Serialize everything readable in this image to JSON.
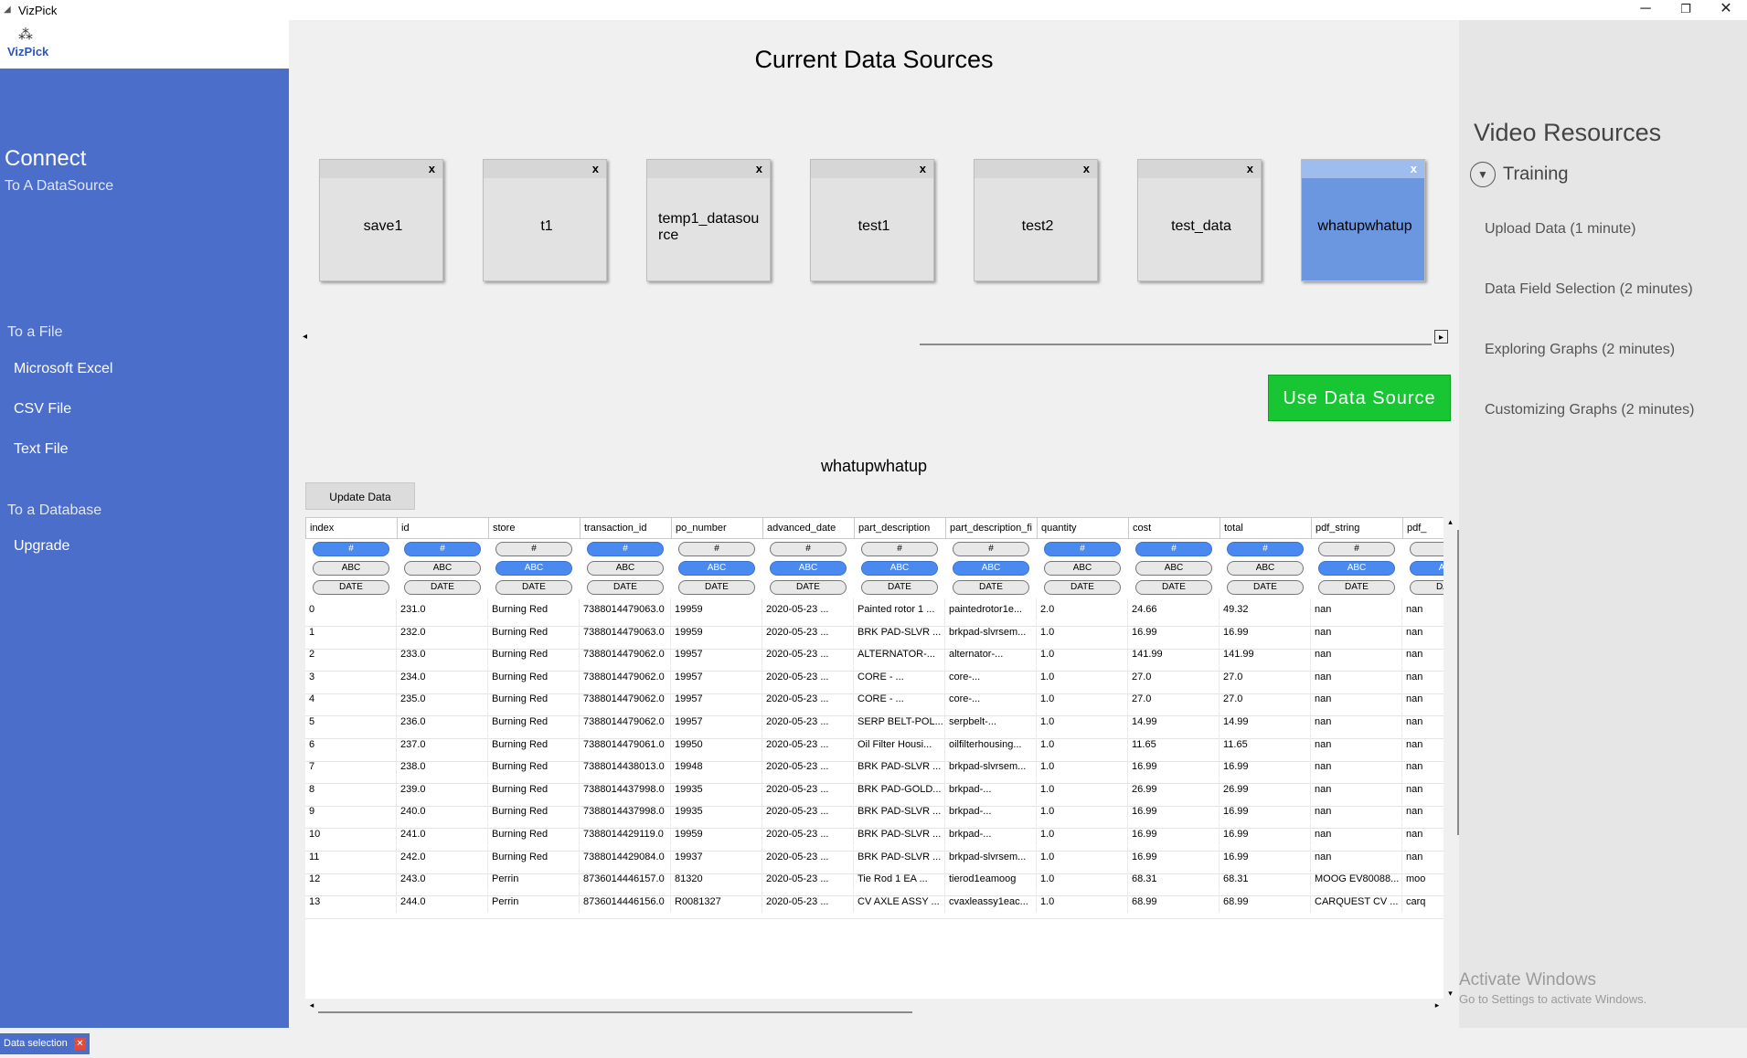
{
  "window": {
    "title": "VizPick",
    "minimize": "─",
    "restore": "❐",
    "close": "✕"
  },
  "logo": {
    "text": "VizPick"
  },
  "sidebar": {
    "title": "Connect",
    "subtitle": "To A DataSource",
    "file_heading": "To a File",
    "file_items": [
      "Microsoft Excel",
      "CSV File",
      "Text File"
    ],
    "db_heading": "To a Database",
    "db_items": [
      "Upgrade"
    ]
  },
  "main": {
    "title": "Current Data Sources",
    "data_sources": [
      {
        "name": "save1",
        "active": false
      },
      {
        "name": "t1",
        "active": false
      },
      {
        "name": "temp1_datasource",
        "active": false
      },
      {
        "name": "test1",
        "active": false
      },
      {
        "name": "test2",
        "active": false
      },
      {
        "name": "test_data",
        "active": false
      },
      {
        "name": "whatupwhatup",
        "active": true
      }
    ],
    "card_close": "x",
    "use_button": "Use Data Source",
    "selected_name": "whatupwhatup",
    "update_button": "Update Data"
  },
  "table": {
    "columns": [
      "index",
      "id",
      "store",
      "transaction_id",
      "po_number",
      "advanced_date",
      "part_description",
      "part_description_fi",
      "quantity",
      "cost",
      "total",
      "pdf_string",
      "pdf_"
    ],
    "type_labels": [
      "#",
      "ABC",
      "DATE"
    ],
    "type_selected": [
      "num",
      "num",
      "abc",
      "num",
      "abc",
      "abc",
      "abc",
      "abc",
      "num",
      "num",
      "num",
      "abc",
      "abc"
    ],
    "rows": [
      [
        "0",
        "231.0",
        "Burning Red",
        "7388014479063.0",
        "19959",
        "2020-05-23 ...",
        "Painted rotor 1 ...",
        "paintedrotor1e...",
        "2.0",
        "24.66",
        "49.32",
        "nan",
        "nan"
      ],
      [
        "1",
        "232.0",
        "Burning Red",
        "7388014479063.0",
        "19959",
        "2020-05-23 ...",
        "BRK PAD-SLVR ...",
        "brkpad-slvrsem...",
        "1.0",
        "16.99",
        "16.99",
        "nan",
        "nan"
      ],
      [
        "2",
        "233.0",
        "Burning Red",
        "7388014479062.0",
        "19957",
        "2020-05-23 ...",
        "ALTERNATOR-...",
        "alternator-...",
        "1.0",
        "141.99",
        "141.99",
        "nan",
        "nan"
      ],
      [
        "3",
        "234.0",
        "Burning Red",
        "7388014479062.0",
        "19957",
        "2020-05-23 ...",
        "CORE - ...",
        "core-...",
        "1.0",
        "27.0",
        "27.0",
        "nan",
        "nan"
      ],
      [
        "4",
        "235.0",
        "Burning Red",
        "7388014479062.0",
        "19957",
        "2020-05-23 ...",
        "CORE - ...",
        "core-...",
        "1.0",
        "27.0",
        "27.0",
        "nan",
        "nan"
      ],
      [
        "5",
        "236.0",
        "Burning Red",
        "7388014479062.0",
        "19957",
        "2020-05-23 ...",
        "SERP BELT-POL...",
        "serpbelt-...",
        "1.0",
        "14.99",
        "14.99",
        "nan",
        "nan"
      ],
      [
        "6",
        "237.0",
        "Burning Red",
        "7388014479061.0",
        "19950",
        "2020-05-23 ...",
        "Oil Filter Housi...",
        "oilfilterhousing...",
        "1.0",
        "11.65",
        "11.65",
        "nan",
        "nan"
      ],
      [
        "7",
        "238.0",
        "Burning Red",
        "7388014438013.0",
        "19948",
        "2020-05-23 ...",
        "BRK PAD-SLVR ...",
        "brkpad-slvrsem...",
        "1.0",
        "16.99",
        "16.99",
        "nan",
        "nan"
      ],
      [
        "8",
        "239.0",
        "Burning Red",
        "7388014437998.0",
        "19935",
        "2020-05-23 ...",
        "BRK PAD-GOLD...",
        "brkpad-...",
        "1.0",
        "26.99",
        "26.99",
        "nan",
        "nan"
      ],
      [
        "9",
        "240.0",
        "Burning Red",
        "7388014437998.0",
        "19935",
        "2020-05-23 ...",
        "BRK PAD-SLVR ...",
        "brkpad-...",
        "1.0",
        "16.99",
        "16.99",
        "nan",
        "nan"
      ],
      [
        "10",
        "241.0",
        "Burning Red",
        "7388014429119.0",
        "19959",
        "2020-05-23 ...",
        "BRK PAD-SLVR ...",
        "brkpad-...",
        "1.0",
        "16.99",
        "16.99",
        "nan",
        "nan"
      ],
      [
        "11",
        "242.0",
        "Burning Red",
        "7388014429084.0",
        "19937",
        "2020-05-23 ...",
        "BRK PAD-SLVR ...",
        "brkpad-slvrsem...",
        "1.0",
        "16.99",
        "16.99",
        "nan",
        "nan"
      ],
      [
        "12",
        "243.0",
        "Perrin",
        "8736014446157.0",
        "81320",
        "2020-05-23 ...",
        "Tie Rod 1 EA ...",
        "tierod1eamoog",
        "1.0",
        "68.31",
        "68.31",
        "MOOG EV80088...",
        "moo"
      ],
      [
        "13",
        "244.0",
        "Perrin",
        "8736014446156.0",
        "R0081327",
        "2020-05-23 ...",
        "CV AXLE ASSY ...",
        "cvaxleassy1eac...",
        "1.0",
        "68.99",
        "68.99",
        "CARQUEST CV ...",
        "carq"
      ]
    ]
  },
  "resources": {
    "title": "Video Resources",
    "section": "Training",
    "links": [
      "Upload Data (1 minute)",
      "Data Field Selection (2 minutes)",
      "Exploring Graphs (2 minutes)",
      "Customizing Graphs (2 minutes)"
    ]
  },
  "watermark": {
    "line1": "Activate Windows",
    "line2": "Go to Settings to activate Windows."
  },
  "status": {
    "tab_label": "Data selection",
    "tab_close": "✕"
  }
}
